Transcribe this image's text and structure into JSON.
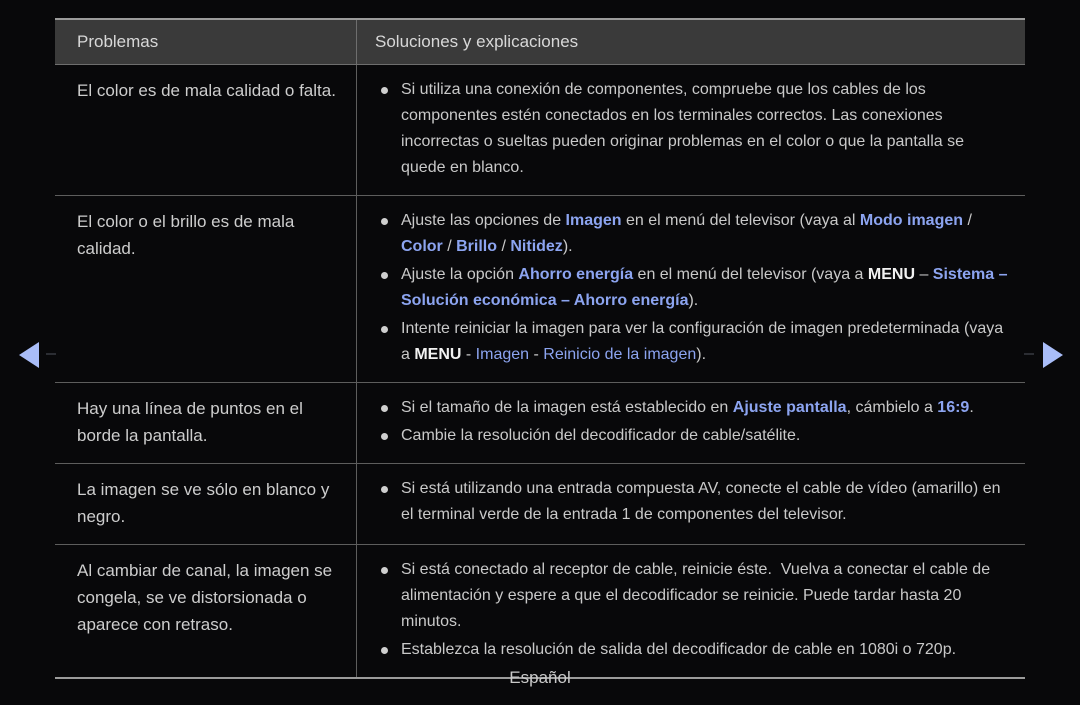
{
  "colors": {
    "background": "#08080a",
    "header_bg": "#3a3a3a",
    "border": "#5d5d5d",
    "outer_border": "#9b9b9b",
    "text": "#c9c9c9",
    "accent_blue": "#8ca4f0",
    "arrow_blue": "#a9bdf8"
  },
  "nav": {
    "prev_label": "◀",
    "next_label": "▶"
  },
  "table": {
    "headers": {
      "problems": "Problemas",
      "solutions": "Soluciones y explicaciones"
    },
    "rows": [
      {
        "problem": "El color es de mala calidad o falta.",
        "solutions": [
          [
            {
              "t": "Si utiliza una conexión de componentes, compruebe que los cables de los componentes estén conectados en los terminales correctos. Las conexiones incorrectas o sueltas pueden originar problemas en el color o que la pantalla se quede en blanco.",
              "s": "n"
            }
          ]
        ]
      },
      {
        "problem": "El color o el brillo es de mala calidad.",
        "solutions": [
          [
            {
              "t": "Ajuste las opciones de ",
              "s": "n"
            },
            {
              "t": "Imagen",
              "s": "b"
            },
            {
              "t": " en el menú del televisor (vaya al ",
              "s": "n"
            },
            {
              "t": "Modo imagen",
              "s": "b"
            },
            {
              "t": " / ",
              "s": "n"
            },
            {
              "t": "Color",
              "s": "b"
            },
            {
              "t": " / ",
              "s": "n"
            },
            {
              "t": "Brillo",
              "s": "b"
            },
            {
              "t": " / ",
              "s": "n"
            },
            {
              "t": "Nitidez",
              "s": "b"
            },
            {
              "t": ").",
              "s": "n"
            }
          ],
          [
            {
              "t": "Ajuste la opción ",
              "s": "n"
            },
            {
              "t": "Ahorro energía",
              "s": "b"
            },
            {
              "t": " en el menú del televisor (vaya a ",
              "s": "n"
            },
            {
              "t": "MENU",
              "s": "w"
            },
            {
              "t": " – ",
              "s": "n"
            },
            {
              "t": "Sistema – Solución económica – Ahorro energía",
              "s": "b"
            },
            {
              "t": ").",
              "s": "n"
            }
          ],
          [
            {
              "t": "Intente reiniciar la imagen para ver la configuración de imagen predeterminada (vaya a ",
              "s": "n"
            },
            {
              "t": "MENU",
              "s": "w"
            },
            {
              "t": " - ",
              "s": "n"
            },
            {
              "t": "Imagen",
              "s": "l"
            },
            {
              "t": " - ",
              "s": "n"
            },
            {
              "t": "Reinicio de la imagen",
              "s": "l"
            },
            {
              "t": ").",
              "s": "n"
            }
          ]
        ]
      },
      {
        "problem": "Hay una línea de puntos en el borde la pantalla.",
        "solutions": [
          [
            {
              "t": "Si el tamaño de la imagen está establecido en ",
              "s": "n"
            },
            {
              "t": "Ajuste pantalla",
              "s": "b"
            },
            {
              "t": ", cámbielo a ",
              "s": "n"
            },
            {
              "t": "16:9",
              "s": "b"
            },
            {
              "t": ".",
              "s": "n"
            }
          ],
          [
            {
              "t": "Cambie la resolución del decodificador de cable/satélite.",
              "s": "n"
            }
          ]
        ]
      },
      {
        "problem": "La imagen se ve sólo en blanco y negro.",
        "solutions": [
          [
            {
              "t": "Si está utilizando una entrada compuesta AV, conecte el cable de vídeo (amarillo) en el terminal verde de la entrada 1 de componentes del televisor.",
              "s": "n"
            }
          ]
        ]
      },
      {
        "problem": "Al cambiar de canal, la imagen se congela, se ve distorsionada o aparece con retraso.",
        "solutions": [
          [
            {
              "t": "Si está conectado al receptor de cable, reinicie éste.  Vuelva a conectar el cable de alimentación y espere a que el decodificador se reinicie. Puede tardar hasta 20 minutos.",
              "s": "n"
            }
          ],
          [
            {
              "t": "Establezca la resolución de salida del decodificador de cable en 1080i o 720p.",
              "s": "n"
            }
          ]
        ]
      }
    ]
  },
  "footer": {
    "language": "Español"
  }
}
